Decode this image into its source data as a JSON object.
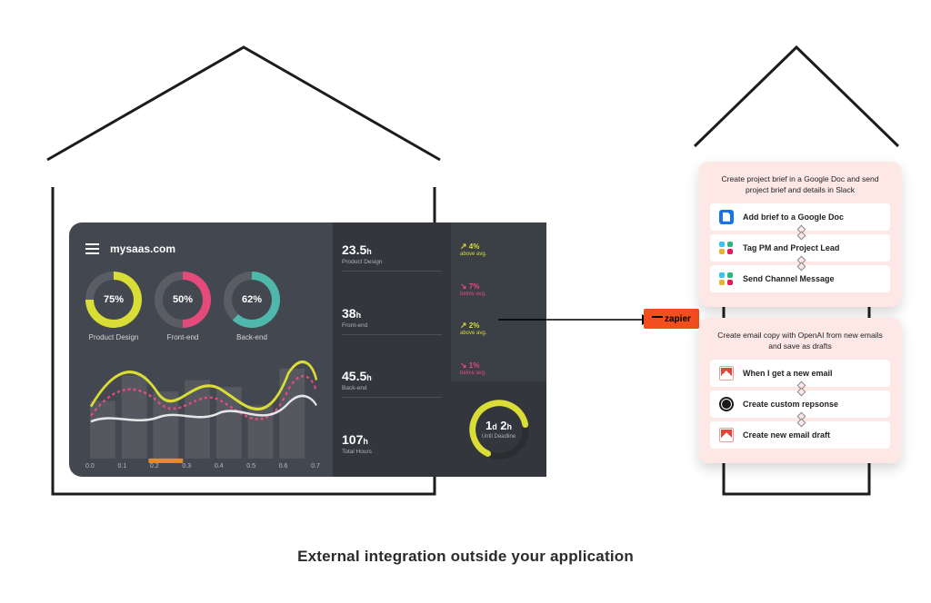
{
  "caption": "External integration outside your application",
  "connector_badge": "zapier",
  "dashboard": {
    "site": "mysaas.com",
    "donuts": [
      {
        "label": "Product Design",
        "pct_label": "75%",
        "pct": 75,
        "color": "#d9dd35"
      },
      {
        "label": "Front-end",
        "pct_label": "50%",
        "pct": 50,
        "color": "#e44b7b"
      },
      {
        "label": "Back-end",
        "pct_label": "62%",
        "pct": 62,
        "color": "#4fb8ac"
      }
    ],
    "xaxis": [
      "0.0",
      "0.1",
      "0.2",
      "0.3",
      "0.4",
      "0.5",
      "0.6",
      "0.7"
    ],
    "stats": [
      {
        "value": "23.5",
        "unit": "h",
        "caption": "Product Design"
      },
      {
        "value": "38",
        "unit": "h",
        "caption": "Front-end"
      },
      {
        "value": "45.5",
        "unit": "h",
        "caption": "Back-end"
      },
      {
        "value": "107",
        "unit": "h",
        "caption": "Total Hours"
      }
    ],
    "trends": [
      {
        "dir": "up",
        "pct": "4%",
        "sub": "above avg."
      },
      {
        "dir": "down",
        "pct": "7%",
        "sub": "below avg."
      },
      {
        "dir": "up",
        "pct": "2%",
        "sub": "above avg."
      },
      {
        "dir": "down",
        "pct": "1%",
        "sub": "below avg."
      }
    ],
    "deadline": {
      "value": "1d 2h",
      "caption": "Until Deadline"
    }
  },
  "workflows": [
    {
      "title": "Create project brief in a Google Doc and send project brief and details in Slack",
      "steps": [
        {
          "icon": "google-doc",
          "label": "Add brief to a Google Doc"
        },
        {
          "icon": "slack",
          "label": "Tag PM and Project Lead"
        },
        {
          "icon": "slack",
          "label": "Send Channel Message"
        }
      ]
    },
    {
      "title": "Create email copy with OpenAI from new emails and save as drafts",
      "steps": [
        {
          "icon": "gmail",
          "label": "When I get a new email"
        },
        {
          "icon": "openai",
          "label": "Create custom repsonse"
        },
        {
          "icon": "gmail",
          "label": "Create new email draft"
        }
      ]
    }
  ]
}
